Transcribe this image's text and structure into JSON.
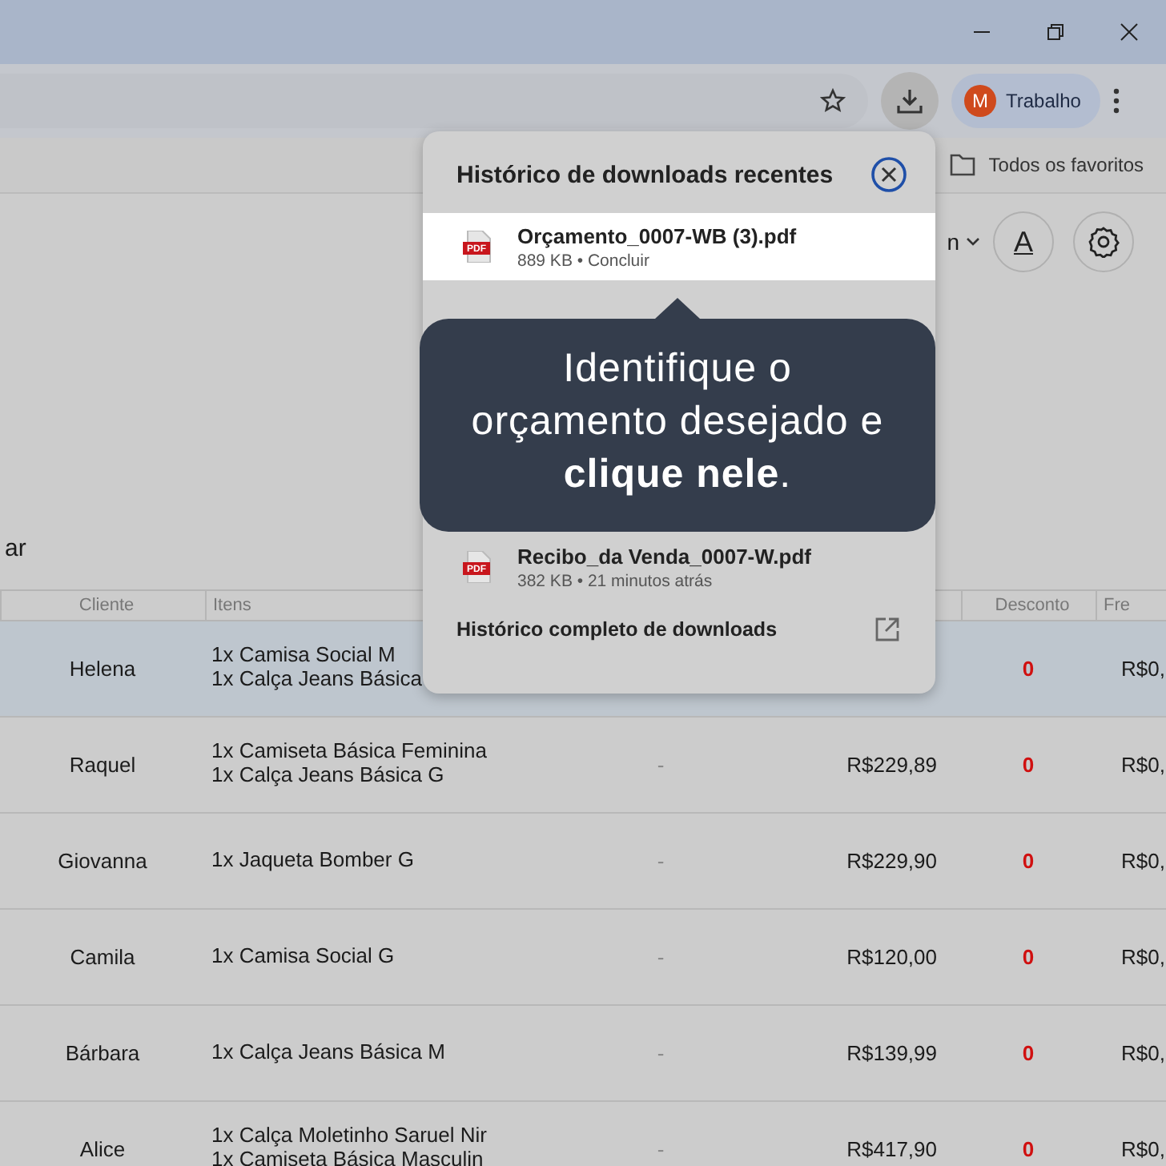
{
  "browser": {
    "profile_initial": "M",
    "profile_name": "Trabalho",
    "bookmarks_label": "Todos os favoritos"
  },
  "page": {
    "field_value": "n",
    "font_button": "A",
    "cut_text": "ar"
  },
  "table": {
    "columns": [
      {
        "kind": "client",
        "label": "Cliente"
      },
      {
        "kind": "items",
        "label": "Itens"
      },
      {
        "kind": "discount",
        "label": "Desconto"
      },
      {
        "kind": "shipping",
        "label": "Fre"
      }
    ],
    "rows": [
      {
        "selected": true,
        "client": "Helena",
        "items": [
          "1x Camisa Social M",
          "1x Calça Jeans Básica"
        ],
        "discount": "0",
        "shipping": "R$0,"
      },
      {
        "selected": false,
        "client": "Raquel",
        "items": [
          "1x Camiseta Básica Feminina",
          "1x Calça Jeans Básica G"
        ],
        "column_3": "-",
        "price": "R$229,89",
        "discount": "0",
        "shipping": "R$0,"
      },
      {
        "selected": false,
        "client": "Giovanna",
        "items": [
          "1x Jaqueta Bomber G"
        ],
        "column_3": "-",
        "price": "R$229,90",
        "discount": "0",
        "shipping": "R$0,"
      },
      {
        "selected": false,
        "client": "Camila",
        "items": [
          "1x Camisa Social G"
        ],
        "column_3": "-",
        "price": "R$120,00",
        "discount": "0",
        "shipping": "R$0,"
      },
      {
        "selected": false,
        "client": "Bárbara",
        "items": [
          "1x Calça Jeans Básica M"
        ],
        "column_3": "-",
        "price": "R$139,99",
        "discount": "0",
        "shipping": "R$0,"
      },
      {
        "selected": false,
        "client": "Alice",
        "items": [
          "1x Calça Moletinho Saruel Nir",
          "1x Camiseta Básica Masculin"
        ],
        "column_3": "-",
        "price": "R$417,90",
        "discount": "0",
        "shipping": "R$0,"
      }
    ]
  },
  "downloads_popup": {
    "title": "Histórico de downloads recentes",
    "items": [
      {
        "highlighted": true,
        "name": "Orçamento_0007-WB (3).pdf",
        "meta": "889 KB • Concluir",
        "badge": "PDF"
      },
      {
        "highlighted": false,
        "name": "Recibo_da Venda_0007-W.pdf",
        "meta": "382 KB • 21 minutos atrás",
        "badge": "PDF"
      }
    ],
    "footer": "Histórico completo de downloads"
  },
  "tooltip": {
    "text": "Identifique o orçamento desejado e **clique nele**."
  }
}
